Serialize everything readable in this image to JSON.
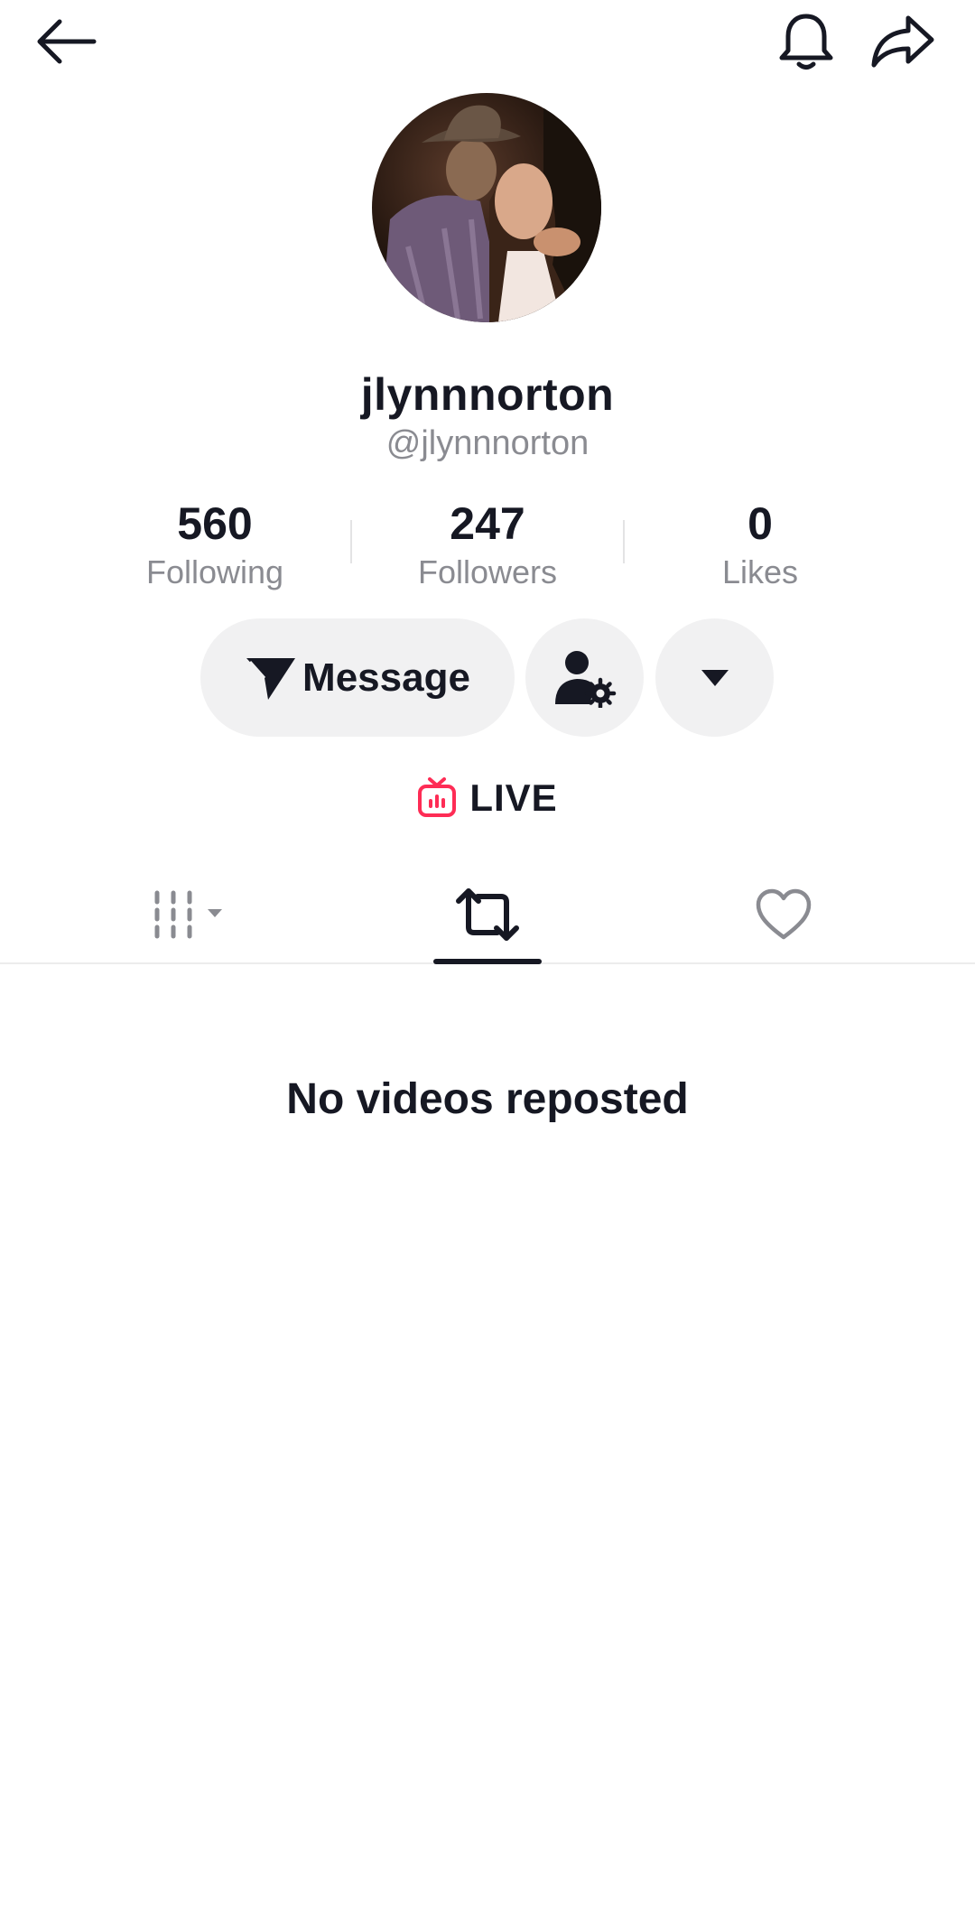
{
  "header": {
    "back_icon": "arrow-left-icon",
    "notification_icon": "bell-icon",
    "share_icon": "share-arrow-icon"
  },
  "profile": {
    "display_name": "jlynnnorton",
    "username": "@jlynnnorton",
    "stats": [
      {
        "value": "560",
        "label": "Following"
      },
      {
        "value": "247",
        "label": "Followers"
      },
      {
        "value": "0",
        "label": "Likes"
      }
    ]
  },
  "actions": {
    "message_label": "Message",
    "message_icon": "send-plane-icon",
    "friend_settings_icon": "user-gear-icon",
    "more_icon": "caret-down-icon"
  },
  "live": {
    "label": "LIVE",
    "icon": "live-tv-icon",
    "icon_color": "#fe2c55"
  },
  "tabs": [
    {
      "name": "videos",
      "icon": "grid-filter-icon",
      "active": false
    },
    {
      "name": "reposts",
      "icon": "repost-icon",
      "active": true
    },
    {
      "name": "liked",
      "icon": "heart-outline-icon",
      "active": false
    }
  ],
  "content": {
    "empty_message": "No videos reposted"
  }
}
